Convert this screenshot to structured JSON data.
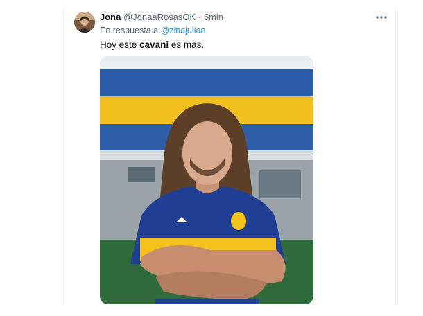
{
  "tweet": {
    "display_name": "Jona",
    "handle": "@JonaaRosasOK",
    "separator": "·",
    "time": "6min",
    "more_icon": "more-horizontal-icon",
    "reply_prefix": "En respuesta a",
    "reply_to": "@zittajulian",
    "text_before": "Hoy este",
    "text_bold": "cavani",
    "text_after": "es mas.",
    "avatar_icon": "avatar-photo",
    "media_icon": "photo-man-in-boca-juniors-jersey"
  },
  "colors": {
    "name": "#0f1419",
    "secondary": "#536471",
    "link": "#1d9bf0",
    "jersey_blue": "#1e3f93",
    "jersey_yellow": "#f5c21b"
  }
}
